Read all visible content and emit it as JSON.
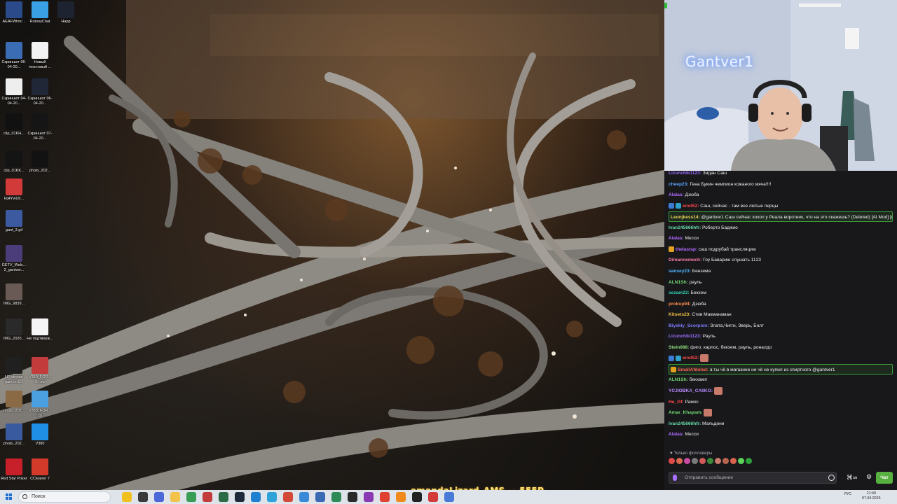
{
  "desktop": {
    "icons": [
      {
        "label": "AEAFWtmc...",
        "color": "#2b4a8a"
      },
      {
        "label": "RutonyChat",
        "color": "#3aa0e6"
      },
      {
        "label": "Happ",
        "color": "#1d2330"
      },
      {
        "label": "Скриншот 06-04-20...",
        "color": "#3a6db3"
      },
      {
        "label": "Новый текстовый ...",
        "color": "#f2f2f2"
      },
      {
        "label": "Скриншот 04-04-20...",
        "color": "#eeeeee"
      },
      {
        "label": "Скриншот 06-04-20...",
        "color": "#202838"
      },
      {
        "label": "clip_01KH...",
        "color": "#111111"
      },
      {
        "label": "Скриншот 07-04-20...",
        "color": "#151515"
      },
      {
        "label": "clip_01KK...",
        "color": "#141414"
      },
      {
        "label": "photo_202...",
        "color": "#121212"
      },
      {
        "label": "kq4YwUb...",
        "color": "#d23a3a"
      },
      {
        "label": "gant_3.gif",
        "color": "#3b5aa0"
      },
      {
        "label": "GETV_Welc... 2_gantver...",
        "color": "#4a3d7a"
      },
      {
        "label": "IMG_9839...",
        "color": "#6a5a55"
      },
      {
        "label": "IMG_2020...",
        "color": "#2a2a2a"
      },
      {
        "label": "Не подтверж...",
        "color": "#f5f5f5"
      },
      {
        "label": "NP stream gantver1...",
        "color": "#202020"
      },
      {
        "label": "V380_FOR... (1).zip",
        "color": "#c43b3b"
      },
      {
        "label": "photo_202...",
        "color": "#8a6a44"
      },
      {
        "label": "V380_FOR... (1)",
        "color": "#4aa0e0"
      },
      {
        "label": "photo_202...",
        "color": "#3a5aa0"
      },
      {
        "label": "V380",
        "color": "#1f8fe6"
      },
      {
        "label": "Red Star Poker",
        "color": "#c8202a"
      },
      {
        "label": "CCleaner 7",
        "color": "#d43a2a"
      }
    ]
  },
  "webcam": {
    "overlay_name": "Gantver1"
  },
  "chat": {
    "messages": [
      {
        "user": "Lizunchik1123:",
        "text": "Зидан Саш",
        "user_color": "#9b6dff",
        "badges": [],
        "emote": false,
        "highlight": false
      },
      {
        "user": "cheep23:",
        "text": "Гена Букин чемпион кожаного мяча!!!!",
        "user_color": "#5aa5ff",
        "badges": [],
        "emote": false,
        "highlight": false
      },
      {
        "user": "Alalas:",
        "text": "Дзюба",
        "user_color": "#b26bff",
        "badges": [],
        "emote": false,
        "highlight": false
      },
      {
        "user": "enot52:",
        "text": "Саш, сейчас - там все лютые перцы",
        "user_color": "#ff4646",
        "badges": [
          "#3a7bd5",
          "#2fa0c8"
        ],
        "emote": false,
        "highlight": false
      },
      {
        "user": "Leonjkess14:",
        "text": "@gantver1 Саш сейчас хохол у Реала воротник, что на это скажешь? (Deleted) [AI Mod] [ненависть]",
        "user_color": "#e8d35a",
        "badges": [],
        "emote": false,
        "highlight": true
      },
      {
        "user": "Ivan245666hfr:",
        "text": "Роберто Баджио",
        "user_color": "#66d9a6",
        "badges": [],
        "emote": false,
        "highlight": false
      },
      {
        "user": "Alalas:",
        "text": "Месси",
        "user_color": "#b26bff",
        "badges": [],
        "emote": false,
        "highlight": false
      },
      {
        "user": "thelastsp:",
        "text": "саш подрубай трансляцию",
        "user_color": "#b26bff",
        "badges": [
          "#e0a020"
        ],
        "emote": false,
        "highlight": false
      },
      {
        "user": "Dimannemech:",
        "text": "Гоу Баварию слушать 1123",
        "user_color": "#ff7aa8",
        "badges": [],
        "emote": false,
        "highlight": false
      },
      {
        "user": "sansey23:",
        "text": "Бензема",
        "user_color": "#4fb7ff",
        "badges": [],
        "emote": false,
        "highlight": false
      },
      {
        "user": "ALN1Sh:",
        "text": "рауль",
        "user_color": "#6fd86f",
        "badges": [],
        "emote": false,
        "highlight": false
      },
      {
        "user": "sezam22:",
        "text": "Бекхем",
        "user_color": "#2fd0b0",
        "badges": [],
        "emote": false,
        "highlight": false
      },
      {
        "user": "prokop94:",
        "text": "Дзюба",
        "user_color": "#ff8c4a",
        "badges": [],
        "emote": false,
        "highlight": false
      },
      {
        "user": "Kitsets23:",
        "text": "Стив Макманаман",
        "user_color": "#f0c040",
        "badges": [],
        "emote": false,
        "highlight": false
      },
      {
        "user": "Biyskiy_Scorpion:",
        "text": "Злата,Чигги, Зверь, Болт",
        "user_color": "#7d7dff",
        "badges": [],
        "emote": false,
        "highlight": false
      },
      {
        "user": "Lizunchik1123:",
        "text": "Рауль",
        "user_color": "#9b6dff",
        "badges": [],
        "emote": false,
        "highlight": false
      },
      {
        "user": "Stein088:",
        "text": "фиго, карлос, бекхем, рауль, роналдо",
        "user_color": "#8fe07a",
        "badges": [],
        "emote": false,
        "highlight": false
      },
      {
        "user": "enot52:",
        "text": "",
        "user_color": "#ff4646",
        "badges": [
          "#3a7bd5",
          "#2fa0c8"
        ],
        "emote": true,
        "highlight": false
      },
      {
        "user": "SmallAfdeled:",
        "text": "а ты чё в магазине не чё не купил из спиртного @gantver1",
        "user_color": "#ff5e5e",
        "badges": [
          "#e0a020"
        ],
        "emote": false,
        "highlight": true
      },
      {
        "user": "ALN1Sh:",
        "text": "бекхамп",
        "user_color": "#6fd86f",
        "badges": [],
        "emote": false,
        "highlight": false
      },
      {
        "user": "YCJIOBKA_CAIIKO:",
        "text": "",
        "user_color": "#b98cff",
        "badges": [],
        "emote": true,
        "highlight": false
      },
      {
        "user": "He_Gf:",
        "text": "Рамос",
        "user_color": "#ff4a4a",
        "badges": [],
        "emote": false,
        "highlight": false
      },
      {
        "user": "Amar_Khayam:",
        "text": "",
        "user_color": "#6fd86f",
        "badges": [],
        "emote": true,
        "highlight": false
      },
      {
        "user": "Ivan245666hfr:",
        "text": "Мальдини",
        "user_color": "#66d9a6",
        "badges": [],
        "emote": false,
        "highlight": false
      },
      {
        "user": "Alalas:",
        "text": "Месси",
        "user_color": "#b26bff",
        "badges": [],
        "emote": false,
        "highlight": false
      }
    ],
    "followers_only_note": "♥ Только фолловеры",
    "emote_colors": [
      "#e24b4b",
      "#d86a52",
      "#c94aa0",
      "#7a7a7a",
      "#d45a5a",
      "#3a8a3a",
      "#c97a6a",
      "#b8644e",
      "#d9634e",
      "#5ad45a",
      "#2f9f3a"
    ],
    "input_placeholder": "Отправить сообщение",
    "send_label": "Чат",
    "bits_icon": "bits-icon",
    "settings_icon": "gear-icon"
  },
  "ticker": {
    "text": "amandaLizard_AMS — 555P"
  },
  "taskbar": {
    "search_label": "Поиск",
    "apps": [
      {
        "name": "widgets",
        "color": "#f0c020"
      },
      {
        "name": "task-view",
        "color": "#3a3a3a"
      },
      {
        "name": "teams",
        "color": "#4a68d8"
      },
      {
        "name": "explorer",
        "color": "#f2c24a"
      },
      {
        "name": "app-green",
        "color": "#3a9d55"
      },
      {
        "name": "app-64",
        "color": "#c43b3b"
      },
      {
        "name": "app-terminal",
        "color": "#2b6b45"
      },
      {
        "name": "app-dark",
        "color": "#1e2a3a"
      },
      {
        "name": "app-blue",
        "color": "#1e7fd0"
      },
      {
        "name": "app-edge",
        "color": "#2fa3d8"
      },
      {
        "name": "app-chrome-red",
        "color": "#d44a3a"
      },
      {
        "name": "app-chrome",
        "color": "#3a8ad8"
      },
      {
        "name": "app-notepad",
        "color": "#3a6ab3"
      },
      {
        "name": "app-green2",
        "color": "#2e8b57"
      },
      {
        "name": "app-obs",
        "color": "#2a2a2a"
      },
      {
        "name": "app-purple",
        "color": "#8a3ab3"
      },
      {
        "name": "app-yandex",
        "color": "#e04030"
      },
      {
        "name": "app-orange",
        "color": "#f08a1a"
      },
      {
        "name": "app-p",
        "color": "#222222"
      },
      {
        "name": "app-red",
        "color": "#d33a3a"
      },
      {
        "name": "app-blue2",
        "color": "#4a7ad8"
      }
    ],
    "tray_text": "РУС",
    "time": "21:49",
    "date": "07.04.2026"
  }
}
